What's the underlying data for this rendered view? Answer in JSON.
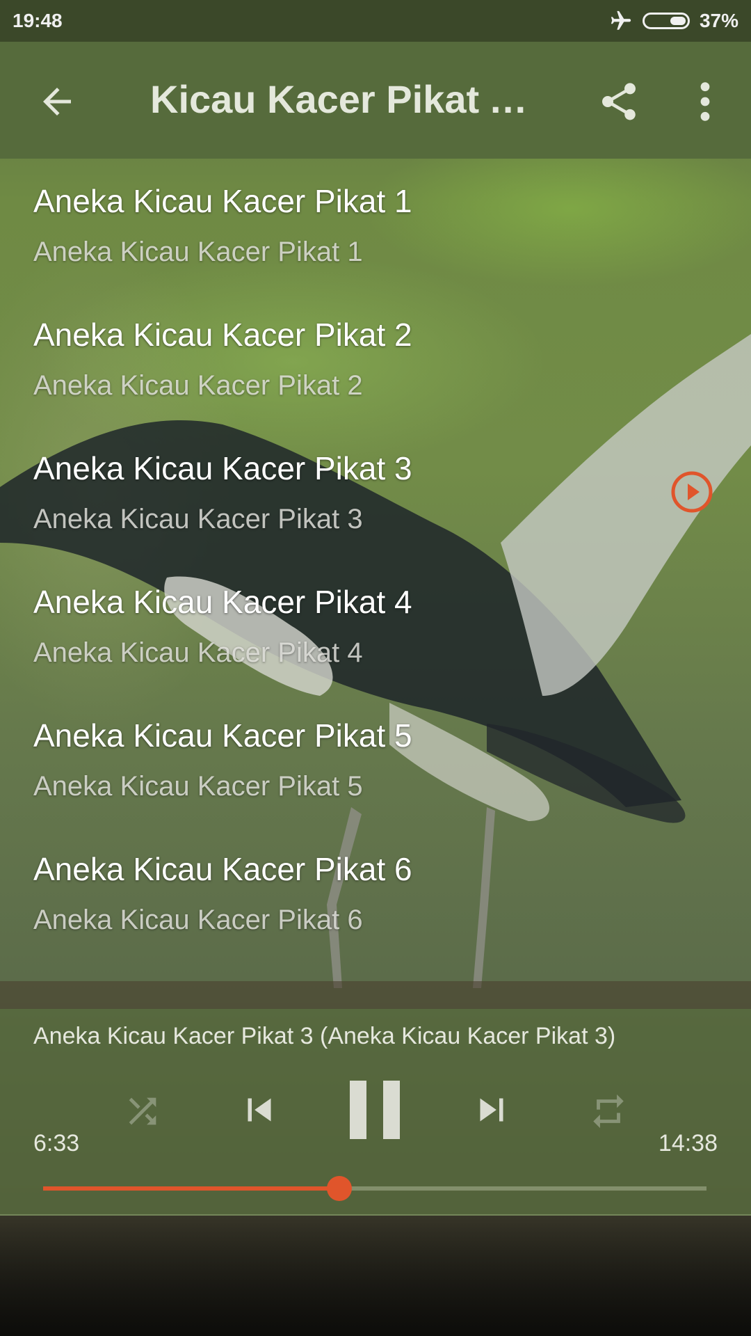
{
  "status": {
    "time": "19:48",
    "battery": "37%",
    "icons": [
      "airplane-icon",
      "battery-icon"
    ]
  },
  "appbar": {
    "title": "Kicau Kacer Pikat A…",
    "icons": [
      "back-arrow-icon",
      "share-icon",
      "more-vert-icon"
    ]
  },
  "tracks": [
    {
      "title": "Aneka Kicau Kacer Pikat 1",
      "subtitle": "Aneka Kicau Kacer Pikat 1"
    },
    {
      "title": "Aneka Kicau Kacer Pikat 2",
      "subtitle": "Aneka Kicau Kacer Pikat 2"
    },
    {
      "title": "Aneka Kicau Kacer Pikat 3",
      "subtitle": "Aneka Kicau Kacer Pikat 3"
    },
    {
      "title": "Aneka Kicau Kacer Pikat 4",
      "subtitle": "Aneka Kicau Kacer Pikat 4"
    },
    {
      "title": "Aneka Kicau Kacer Pikat 5",
      "subtitle": "Aneka Kicau Kacer Pikat 5"
    },
    {
      "title": "Aneka Kicau Kacer Pikat 6",
      "subtitle": "Aneka Kicau Kacer Pikat 6"
    }
  ],
  "player": {
    "now_playing": "Aneka Kicau Kacer Pikat 3 (Aneka Kicau Kacer Pikat 3)",
    "elapsed": "6:33",
    "duration": "14:38",
    "progress_fraction": 0.447,
    "controls": [
      "shuffle-icon",
      "previous-icon",
      "pause-icon",
      "next-icon",
      "repeat-icon"
    ]
  },
  "colors": {
    "accent": "#e0552b",
    "appbar": "#566b3c",
    "statusbar": "#3b4829"
  }
}
